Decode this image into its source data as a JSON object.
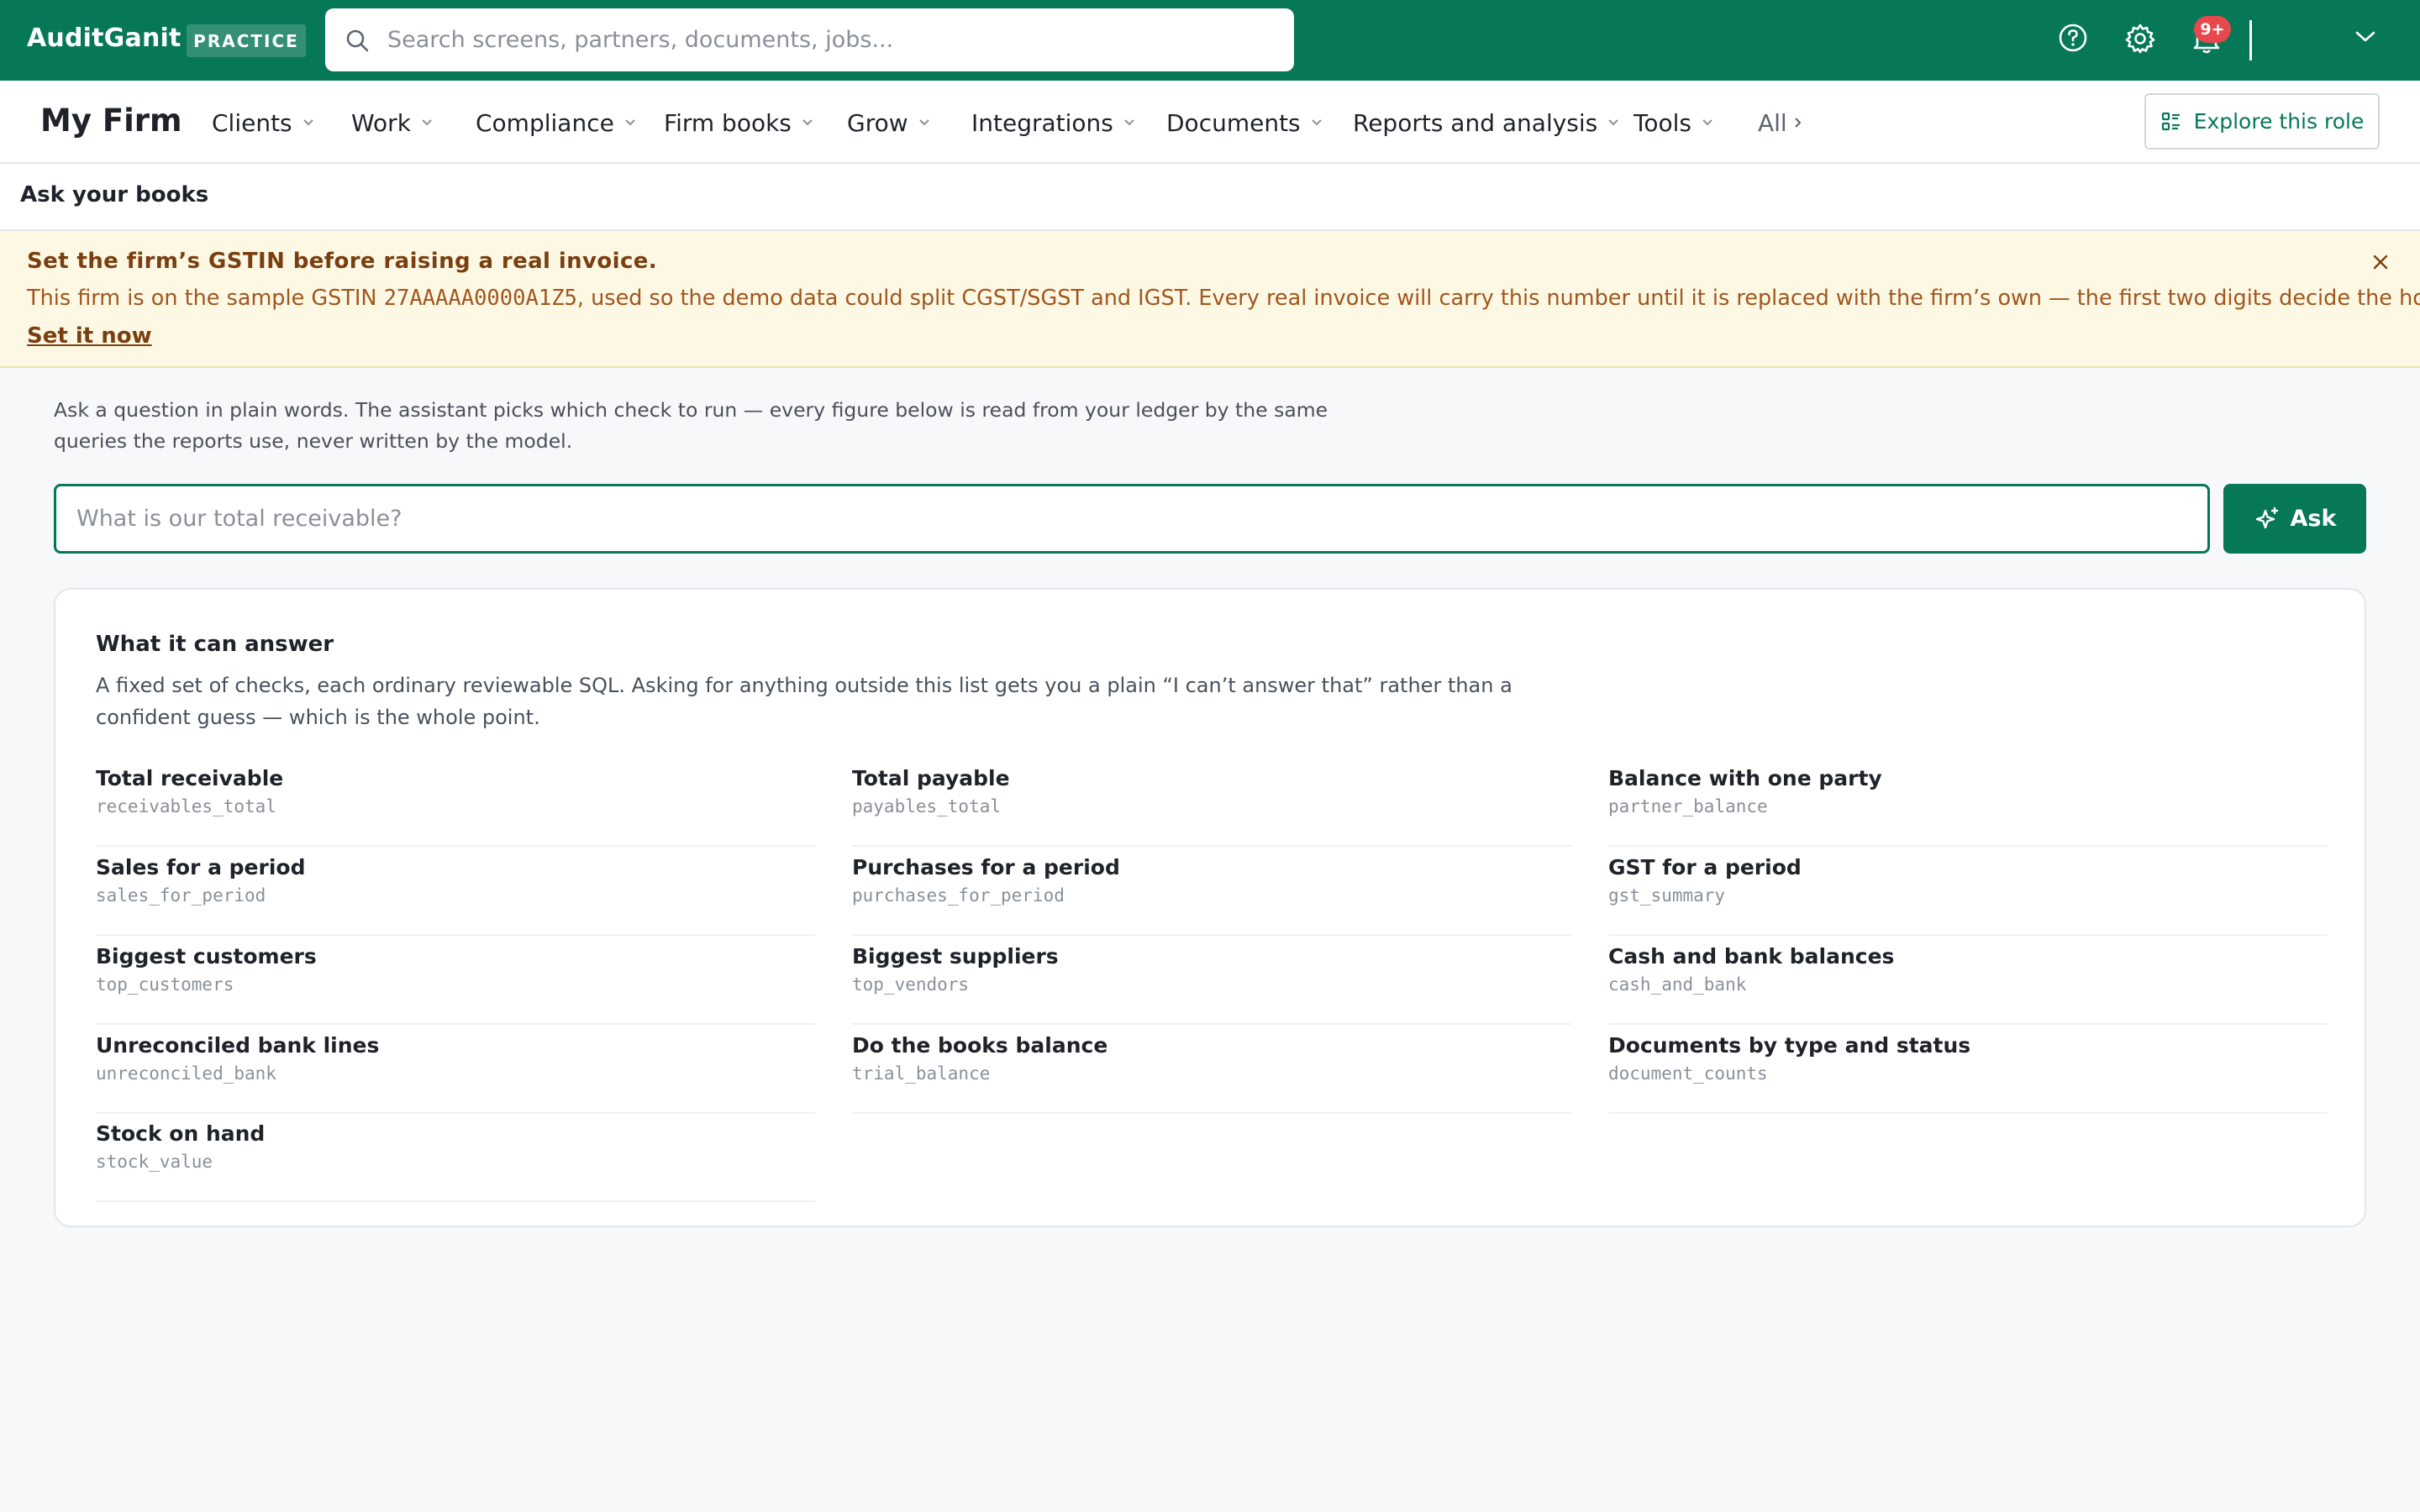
{
  "app": {
    "brand": "AuditGanit",
    "mode_badge": "PRACTICE",
    "search_placeholder": "Search screens, partners, documents, jobs...",
    "notification_count": "9+"
  },
  "nav": {
    "firm_title": "My Firm",
    "items": [
      "Clients",
      "Work",
      "Compliance",
      "Firm books",
      "Grow",
      "Integrations",
      "Documents",
      "Reports and analysis",
      "Tools"
    ],
    "all_label": "All",
    "explore_label": "Explore this role"
  },
  "page": {
    "title": "Ask your books"
  },
  "banner": {
    "title": "Set the firm’s GSTIN before raising a real invoice.",
    "text_before": "This firm is on the sample GSTIN ",
    "gstin": "27AAAAA0000A1Z5",
    "text_after": ", used so the demo data could split CGST/SGST and IGST. Every real invoice will carry this number until it is replaced with the firm’s own — the first two digits decide the home state.",
    "link": "Set it now"
  },
  "ask": {
    "intro": "Ask a question in plain words. The assistant picks which check to run — every figure below is read from your ledger by the same queries the reports use, never written by the model.",
    "placeholder": "What is our total receivable?",
    "button": "Ask"
  },
  "capabilities": {
    "title": "What it can answer",
    "description": "A fixed set of checks, each ordinary reviewable SQL. Asking for anything outside this list gets you a plain “I can’t answer that” rather than a confident guess — which is the whole point.",
    "items": [
      {
        "label": "Total receivable",
        "code": "receivables_total"
      },
      {
        "label": "Total payable",
        "code": "payables_total"
      },
      {
        "label": "Balance with one party",
        "code": "partner_balance"
      },
      {
        "label": "Sales for a period",
        "code": "sales_for_period"
      },
      {
        "label": "Purchases for a period",
        "code": "purchases_for_period"
      },
      {
        "label": "GST for a period",
        "code": "gst_summary"
      },
      {
        "label": "Biggest customers",
        "code": "top_customers"
      },
      {
        "label": "Biggest suppliers",
        "code": "top_vendors"
      },
      {
        "label": "Cash and bank balances",
        "code": "cash_and_bank"
      },
      {
        "label": "Unreconciled bank lines",
        "code": "unreconciled_bank"
      },
      {
        "label": "Do the books balance",
        "code": "trial_balance"
      },
      {
        "label": "Documents by type and status",
        "code": "document_counts"
      },
      {
        "label": "Stock on hand",
        "code": "stock_value"
      }
    ]
  },
  "colors": {
    "brand_green": "#077857",
    "banner_bg": "#fdf8e4",
    "banner_text": "#a1561d",
    "notification_red": "#e5484d"
  }
}
